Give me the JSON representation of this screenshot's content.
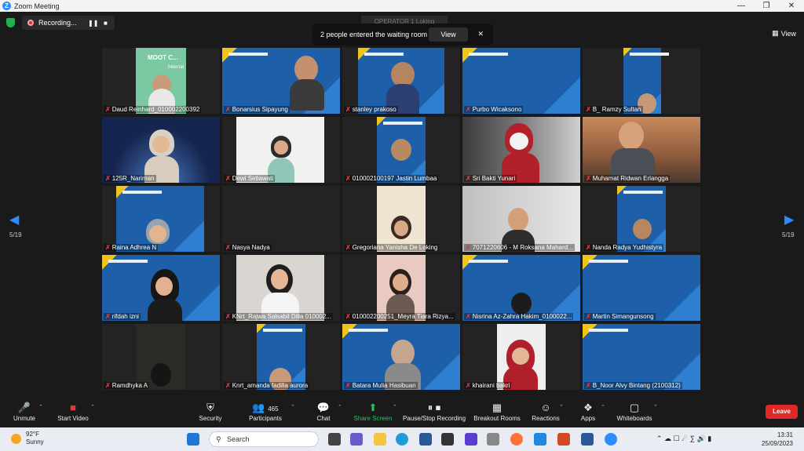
{
  "window": {
    "title": "Zoom Meeting",
    "controls": [
      "—",
      "❐",
      "✕"
    ]
  },
  "recording": {
    "label": "Recording..."
  },
  "operator_banner": "OPERATOR 1 Loking",
  "notification": {
    "text": "2 people entered the waiting room",
    "view_label": "View"
  },
  "view_label": "View",
  "page_indicator": {
    "left": "5/19",
    "right": "5/19"
  },
  "participants": [
    "Daud Reinhard_010002200392",
    "Bonarsius Sipayung",
    "stanley prakoso",
    "Purbo Wicaksono",
    "B_ Ramzy Sultan",
    "125R_Nariman",
    "Dewi Setiawati",
    "010002100197 Jastin Lumbaa",
    "Sri Bakti Yunari",
    "Muhamat Ridwan Erlangga",
    "Raina Adhrea N",
    "Nasya Nadya",
    "Gregoriana Yanisha De Loking",
    "7071220606 - M Roksana Mahard...",
    "Nanda Radya Yudhistyra",
    "rifdah izni",
    "KNrt_Rajwa Salsabil Dilla 010002...",
    "010002200251_Meyra Tiara Rizya...",
    "Nisrina Az-Zahra Hakim_0100022...",
    "Martin Simangunsong",
    "Ramdhyka A",
    "Knrt_amanda fadilla aurora",
    "Batara Mulia Hasibuan",
    "khairani bakri",
    "B_Noor Alvy Bintang (2100312)"
  ],
  "tile_text": {
    "moot": "MOOT C...",
    "internal": "Internal"
  },
  "toolbar": {
    "unmute": "Unmute",
    "start_video": "Start Video",
    "security": "Security",
    "participants": "Participants",
    "participants_count": "465",
    "chat": "Chat",
    "share_screen": "Share Screen",
    "pause_stop": "Pause/Stop Recording",
    "breakout": "Breakout Rooms",
    "reactions": "Reactions",
    "apps": "Apps",
    "whiteboards": "Whiteboards",
    "leave": "Leave"
  },
  "taskbar": {
    "temp": "92°F",
    "condition": "Sunny",
    "search_placeholder": "Search",
    "time": "13:31",
    "date": "25/09/2023"
  }
}
